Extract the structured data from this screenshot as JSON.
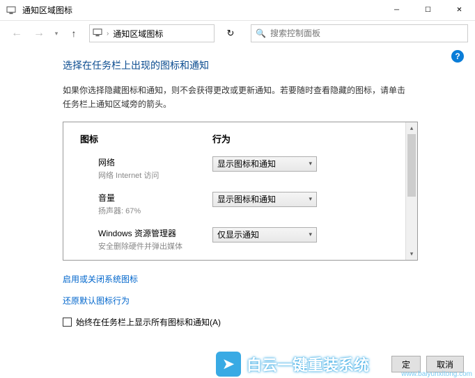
{
  "window": {
    "title": "通知区域图标"
  },
  "nav": {
    "breadcrumb": "通知区域图标",
    "search_placeholder": "搜索控制面板"
  },
  "page": {
    "heading": "选择在任务栏上出现的图标和通知",
    "description": "如果你选择隐藏图标和通知，则不会获得更改或更新通知。若要随时查看隐藏的图标，请单击任务栏上通知区域旁的箭头。"
  },
  "table": {
    "header_icon": "图标",
    "header_behavior": "行为",
    "rows": [
      {
        "title": "网络",
        "subtitle": "网络 Internet 访问",
        "behavior": "显示图标和通知"
      },
      {
        "title": "音量",
        "subtitle": "扬声器: 67%",
        "behavior": "显示图标和通知"
      },
      {
        "title": "Windows 资源管理器",
        "subtitle": "安全删除硬件并弹出媒体",
        "behavior": "仅显示通知"
      }
    ]
  },
  "links": {
    "toggle_system_icons": "启用或关闭系统图标",
    "restore_defaults": "还原默认图标行为"
  },
  "checkbox": {
    "label": "始终在任务栏上显示所有图标和通知(A)"
  },
  "buttons": {
    "ok": "定",
    "cancel": "取消"
  },
  "watermark": {
    "brand": "白云一键重装系统",
    "url": "www.baiyunxitong.com"
  }
}
